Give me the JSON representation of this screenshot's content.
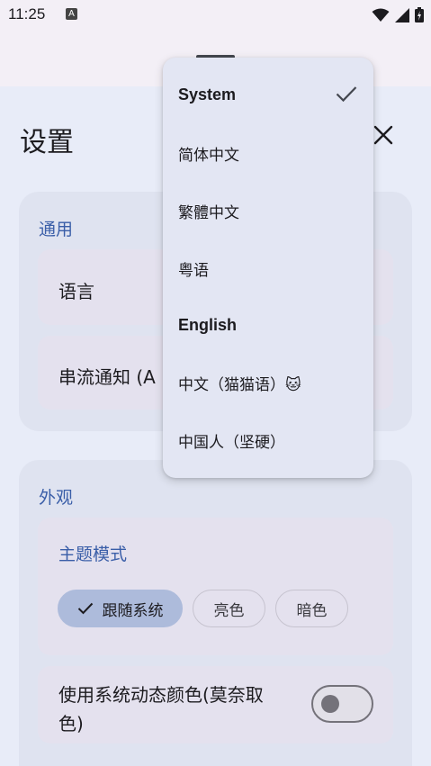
{
  "status_bar": {
    "time": "11:25",
    "notification_icon": "A"
  },
  "page_title": "设置",
  "close_icon": "close-icon",
  "general": {
    "title": "通用",
    "language_label": "语言",
    "stream_notification_label": "串流通知 (A"
  },
  "appearance": {
    "title": "外观",
    "theme_mode_title": "主题模式",
    "chips": [
      {
        "label": "跟随系统",
        "selected": true
      },
      {
        "label": "亮色",
        "selected": false
      },
      {
        "label": "暗色",
        "selected": false
      }
    ],
    "dynamic_color_label_line1": "使用系统动态颜色(莫奈取",
    "dynamic_color_label_line2": "色)",
    "dynamic_color_enabled": false
  },
  "language_menu": {
    "selected": "System",
    "items": [
      {
        "label": "System"
      },
      {
        "label": "简体中文"
      },
      {
        "label": "繁體中文"
      },
      {
        "label": "粤语"
      },
      {
        "label": "English"
      },
      {
        "label": "中文（猫猫语）🐱"
      },
      {
        "label": "中国人（坚硬）"
      }
    ]
  },
  "colors": {
    "accent": "#3a5ea8",
    "selected_chip": "#adbbdb",
    "sheet_bg": "#e8ecf8"
  }
}
